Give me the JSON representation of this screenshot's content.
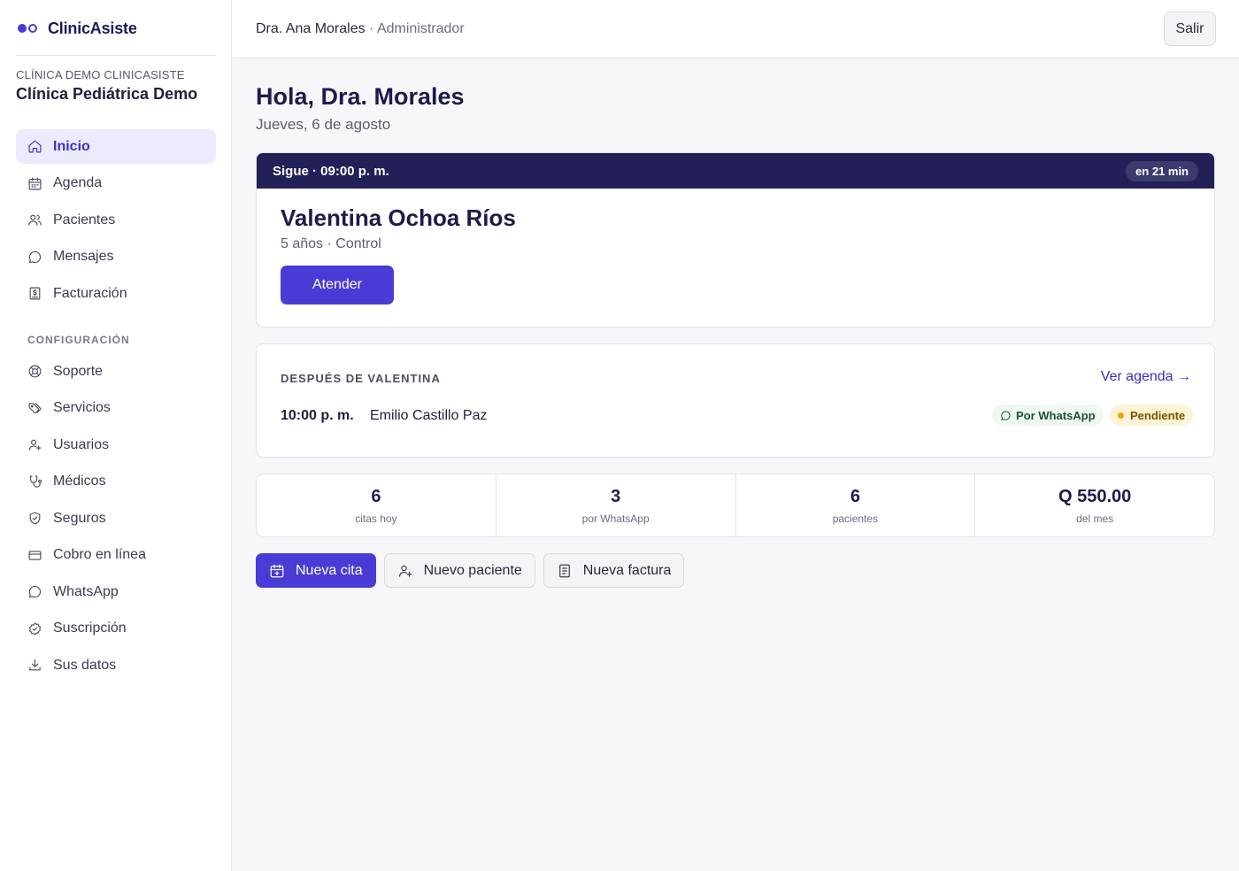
{
  "brand": {
    "name": "ClinicAsiste"
  },
  "clinic": {
    "kicker": "CLÍNICA DEMO CLINICASISTE",
    "name": "Clínica Pediátrica Demo"
  },
  "nav_main": [
    {
      "label": "Inicio",
      "icon": "home-icon",
      "active": true
    },
    {
      "label": "Agenda",
      "icon": "calendar-icon"
    },
    {
      "label": "Pacientes",
      "icon": "users-icon"
    },
    {
      "label": "Mensajes",
      "icon": "message-icon"
    },
    {
      "label": "Facturación",
      "icon": "invoice-icon"
    }
  ],
  "nav_config_title": "CONFIGURACIÓN",
  "nav_config": [
    {
      "label": "Soporte",
      "icon": "lifebuoy-icon"
    },
    {
      "label": "Servicios",
      "icon": "tags-icon"
    },
    {
      "label": "Usuarios",
      "icon": "user-plus-icon"
    },
    {
      "label": "Médicos",
      "icon": "stethoscope-icon"
    },
    {
      "label": "Seguros",
      "icon": "shield-icon"
    },
    {
      "label": "Cobro en línea",
      "icon": "credit-card-icon"
    },
    {
      "label": "WhatsApp",
      "icon": "whatsapp-icon"
    },
    {
      "label": "Suscripción",
      "icon": "badge-check-icon"
    },
    {
      "label": "Sus datos",
      "icon": "download-icon"
    }
  ],
  "topbar": {
    "user": "Dra. Ana Morales",
    "separator": " · ",
    "role": "Administrador",
    "logout": "Salir"
  },
  "main": {
    "greeting": "Hola, Dra. Morales",
    "date": "Jueves, 6 de agosto"
  },
  "next": {
    "label": "Sigue · 09:00 p. m.",
    "badge": "en 21 min",
    "patient": "Valentina Ochoa Ríos",
    "meta": "5 años · Control",
    "action": "Atender"
  },
  "after": {
    "kicker": "DESPUÉS DE VALENTINA",
    "link": "Ver agenda →",
    "time": "10:00 p. m.",
    "patient": "Emilio Castillo Paz",
    "channel": "Por WhatsApp",
    "status": "Pendiente"
  },
  "stats": [
    {
      "value": "6",
      "label": "citas hoy"
    },
    {
      "value": "3",
      "label": "por WhatsApp"
    },
    {
      "value": "6",
      "label": "pacientes"
    },
    {
      "value": "Q 550.00",
      "label": "del mes"
    }
  ],
  "actions": {
    "new_appointment": "Nueva cita",
    "new_patient": "Nuevo paciente",
    "new_invoice": "Nueva factura"
  },
  "colors": {
    "accent": "#4a3bd6",
    "header_dark": "#232057",
    "whatsapp_chip": "#eef8f1",
    "pending_chip": "#fdf3d6"
  }
}
